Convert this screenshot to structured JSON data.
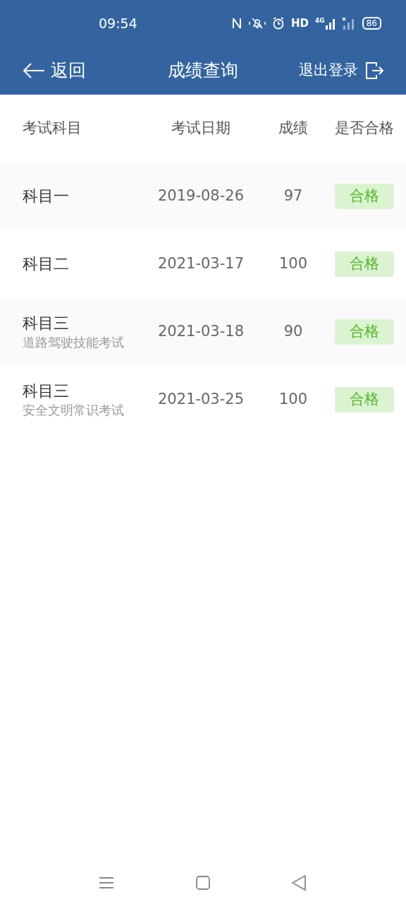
{
  "status_bar": {
    "time": "09:54",
    "hd": "HD",
    "network": "4G",
    "battery": "86"
  },
  "header": {
    "back": "返回",
    "title": "成绩查询",
    "logout": "退出登录"
  },
  "table": {
    "columns": [
      "考试科目",
      "考试日期",
      "成绩",
      "是否合格"
    ],
    "rows": [
      {
        "subject": "科目一",
        "date": "2019-08-26",
        "score": "97",
        "result": "合格",
        "passed": true
      },
      {
        "subject": "科目二",
        "date": "2021-03-17",
        "score": "100",
        "result": "合格",
        "passed": true
      },
      {
        "subject": "科目三",
        "note": "道路驾驶技能考试",
        "date": "2021-03-18",
        "score": "90",
        "result": "合格",
        "passed": true
      },
      {
        "subject": "科目三",
        "note": "安全文明常识考试",
        "date": "2021-03-25",
        "score": "100",
        "result": "合格",
        "passed": true
      }
    ]
  }
}
